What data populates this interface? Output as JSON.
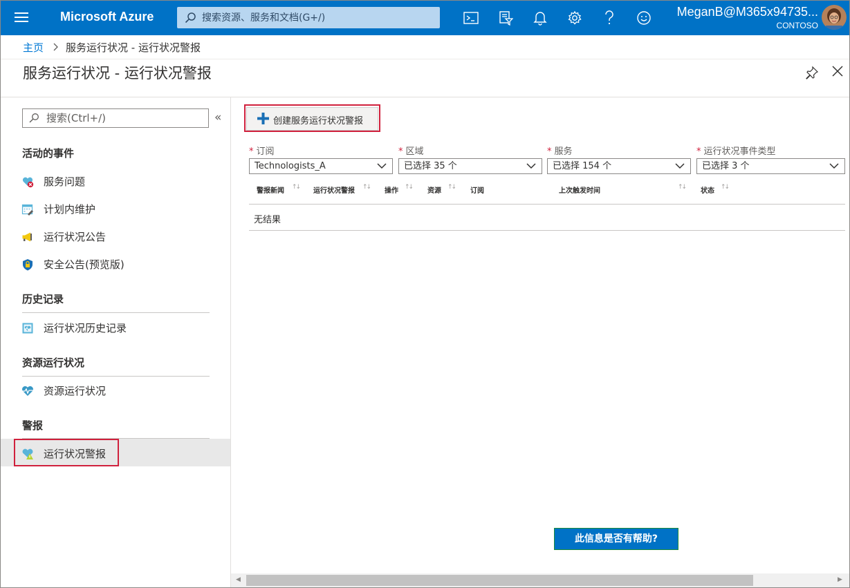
{
  "topbar": {
    "brand": "Microsoft Azure",
    "search_placeholder": "搜索资源、服务和文档(G+/)",
    "user_name": "MeganB@M365x94735...",
    "tenant": "CONTOSO",
    "icons": [
      "cloud-shell-icon",
      "directory-filter-icon",
      "notifications-icon",
      "settings-icon",
      "help-icon",
      "feedback-smiley-icon"
    ]
  },
  "breadcrumb": {
    "home": "主页",
    "current": "服务运行状况 - 运行状况警报"
  },
  "page": {
    "title": "服务运行状况 - 运行状况警报"
  },
  "sidebar": {
    "search_placeholder": "搜索(Ctrl+/)",
    "collapse_glyph": "«",
    "sections": [
      {
        "title": "活动的事件",
        "items": [
          {
            "label": "服务问题",
            "icon": "service-issues-icon"
          },
          {
            "label": "计划内维护",
            "icon": "planned-maintenance-icon"
          },
          {
            "label": "运行状况公告",
            "icon": "health-advisory-icon"
          },
          {
            "label": "安全公告(预览版)",
            "icon": "security-advisory-icon"
          }
        ]
      },
      {
        "title": "历史记录",
        "items": [
          {
            "label": "运行状况历史记录",
            "icon": "health-history-icon"
          }
        ]
      },
      {
        "title": "资源运行状况",
        "items": [
          {
            "label": "资源运行状况",
            "icon": "resource-health-icon"
          }
        ]
      },
      {
        "title": "警报",
        "items": [
          {
            "label": "运行状况警报",
            "icon": "health-alerts-icon",
            "selected": true
          }
        ]
      }
    ]
  },
  "main": {
    "create_button": "创建服务运行状况警报",
    "filters": [
      {
        "label": "订阅",
        "value": "Technologists_A",
        "required": true
      },
      {
        "label": "区域",
        "value": "已选择 35 个",
        "required": true
      },
      {
        "label": "服务",
        "value": "已选择 154 个",
        "required": true
      },
      {
        "label": "运行状况事件类型",
        "value": "已选择 3 个",
        "required": true
      }
    ],
    "columns": [
      "警报新闻",
      "运行状况警报",
      "操作",
      "资源",
      "订阅",
      "上次触发时间",
      "状态"
    ],
    "no_results": "无结果",
    "feedback_button": "此信息是否有帮助?"
  },
  "colors": {
    "topbar": "#0072c6",
    "accent": "#0078d4",
    "highlight": "#d0203c"
  }
}
